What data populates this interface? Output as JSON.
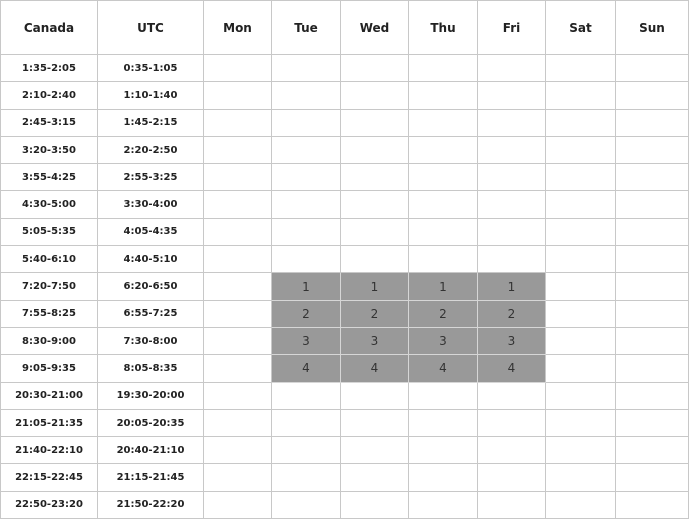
{
  "header": [
    "Canada",
    "UTC",
    "Mon",
    "Tue",
    "Wed",
    "Thu",
    "Fri",
    "Sat",
    "Sun"
  ],
  "rows": [
    {
      "canada": "1:35-2:05",
      "utc": "0:35-1:05",
      "slots": [
        "",
        "",
        "",
        "",
        "",
        "",
        ""
      ]
    },
    {
      "canada": "2:10-2:40",
      "utc": "1:10-1:40",
      "slots": [
        "",
        "",
        "",
        "",
        "",
        "",
        ""
      ]
    },
    {
      "canada": "2:45-3:15",
      "utc": "1:45-2:15",
      "slots": [
        "",
        "",
        "",
        "",
        "",
        "",
        ""
      ]
    },
    {
      "canada": "3:20-3:50",
      "utc": "2:20-2:50",
      "slots": [
        "",
        "",
        "",
        "",
        "",
        "",
        ""
      ]
    },
    {
      "canada": "3:55-4:25",
      "utc": "2:55-3:25",
      "slots": [
        "",
        "",
        "",
        "",
        "",
        "",
        ""
      ]
    },
    {
      "canada": "4:30-5:00",
      "utc": "3:30-4:00",
      "slots": [
        "",
        "",
        "",
        "",
        "",
        "",
        ""
      ]
    },
    {
      "canada": "5:05-5:35",
      "utc": "4:05-4:35",
      "slots": [
        "",
        "",
        "",
        "",
        "",
        "",
        ""
      ]
    },
    {
      "canada": "5:40-6:10",
      "utc": "4:40-5:10",
      "slots": [
        "",
        "",
        "",
        "",
        "",
        "",
        ""
      ]
    },
    {
      "canada": "7:20-7:50",
      "utc": "6:20-6:50",
      "slots": [
        "",
        "1",
        "1",
        "1",
        "1",
        "",
        ""
      ]
    },
    {
      "canada": "7:55-8:25",
      "utc": "6:55-7:25",
      "slots": [
        "",
        "2",
        "2",
        "2",
        "2",
        "",
        ""
      ]
    },
    {
      "canada": "8:30-9:00",
      "utc": "7:30-8:00",
      "slots": [
        "",
        "3",
        "3",
        "3",
        "3",
        "",
        ""
      ]
    },
    {
      "canada": "9:05-9:35",
      "utc": "8:05-8:35",
      "slots": [
        "",
        "4",
        "4",
        "4",
        "4",
        "",
        ""
      ]
    },
    {
      "canada": "20:30-21:00",
      "utc": "19:30-20:00",
      "slots": [
        "",
        "",
        "",
        "",
        "",
        "",
        ""
      ]
    },
    {
      "canada": "21:05-21:35",
      "utc": "20:05-20:35",
      "slots": [
        "",
        "",
        "",
        "",
        "",
        "",
        ""
      ]
    },
    {
      "canada": "21:40-22:10",
      "utc": "20:40-21:10",
      "slots": [
        "",
        "",
        "",
        "",
        "",
        "",
        ""
      ]
    },
    {
      "canada": "22:15-22:45",
      "utc": "21:15-21:45",
      "slots": [
        "",
        "",
        "",
        "",
        "",
        "",
        ""
      ]
    },
    {
      "canada": "22:50-23:20",
      "utc": "21:50-22:20",
      "slots": [
        "",
        "",
        "",
        "",
        "",
        "",
        ""
      ]
    }
  ],
  "colors": {
    "booked_fill": "#999999",
    "grid_line": "#c8c8c8"
  }
}
